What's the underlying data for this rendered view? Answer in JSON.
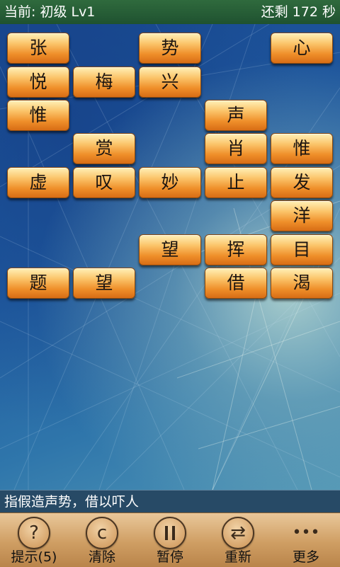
{
  "status": {
    "level_text": "当前: 初级 Lv1",
    "time_text": "还剩 172 秒"
  },
  "tiles": [
    {
      "char": "张"
    },
    {
      "char": "势"
    },
    {
      "char": "心"
    },
    {
      "char": "悦"
    },
    {
      "char": "梅"
    },
    {
      "char": "兴"
    },
    {
      "char": "惟"
    },
    {
      "char": "声"
    },
    {
      "char": "赏"
    },
    {
      "char": "肖"
    },
    {
      "char": "惟"
    },
    {
      "char": "虚"
    },
    {
      "char": "叹"
    },
    {
      "char": "妙"
    },
    {
      "char": "止"
    },
    {
      "char": "发"
    },
    {
      "char": "洋"
    },
    {
      "char": "望"
    },
    {
      "char": "挥"
    },
    {
      "char": "目"
    },
    {
      "char": "题"
    },
    {
      "char": "望"
    },
    {
      "char": "借"
    },
    {
      "char": "渴"
    }
  ],
  "hint": {
    "text": "指假造声势，借以吓人"
  },
  "toolbar": {
    "hint_label": "提示(5)",
    "hint_glyph": "?",
    "clear_label": "清除",
    "clear_glyph": "c",
    "pause_label": "暂停",
    "restart_label": "重新",
    "restart_glyph": "⇄",
    "more_label": "更多",
    "more_glyph": "•••"
  },
  "colors": {
    "status_bar": "#2f6a3d",
    "tile": "#ef8f2a",
    "hint_bar": "#274a66",
    "toolbar": "#cf9e63"
  }
}
